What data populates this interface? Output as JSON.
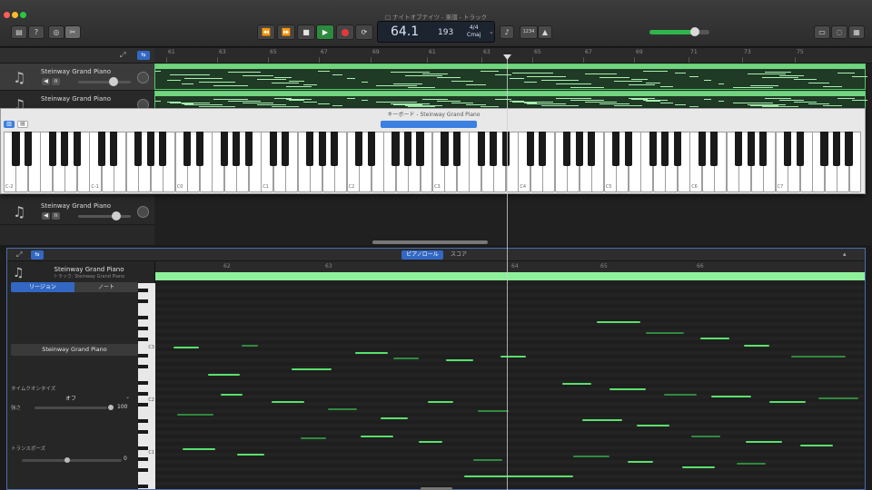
{
  "window": {
    "title": "□ ナイトオブナイツ - 楽譜 - トラック"
  },
  "toolbar": {
    "library_icon": "library-icon",
    "quick_help_icon": "help-icon",
    "smart_controls_icon": "smart-controls-icon",
    "editors_icon": "scissors-icon",
    "rewind_label": "⏪",
    "forward_label": "⏩",
    "stop_label": "■",
    "play_label": "▶",
    "cycle_label": "⟳",
    "lcd": {
      "position": "64.1",
      "tempo": "193",
      "time_signature": "4/4",
      "key": "Cmaj"
    },
    "tuner_label": "♪",
    "count_in_label": "1234",
    "metronome_label": "▲"
  },
  "tracks": [
    {
      "name": "Steinway Grand Piano"
    },
    {
      "name": "Steinway Grand Piano"
    },
    {
      "name": "Steinway Grand Piano"
    }
  ],
  "ruler": {
    "bars": [
      "61",
      "63",
      "65",
      "67",
      "69",
      "61",
      "63",
      "65",
      "67",
      "69",
      "71",
      "73",
      "75"
    ]
  },
  "keyboard": {
    "title": "キーボード - Steinway Grand Piano",
    "octave_labels": [
      "C-2",
      "C-1",
      "C0",
      "C1",
      "C2",
      "C3",
      "C4",
      "C5",
      "C6",
      "C7"
    ]
  },
  "editor": {
    "tabs": {
      "piano_roll": "ピアノロール",
      "score": "スコア"
    },
    "track_name": "Steinway Grand Piano",
    "track_sub": "トラック: Steinway Grand Piano",
    "segments": {
      "region": "リージョン",
      "note": "ノート"
    },
    "region_name": "Steinway Grand Piano",
    "time_quantize_label": "タイムクオンタイズ",
    "time_quantize_value": "オフ",
    "strength_label": "強さ",
    "strength_value": "100",
    "transpose_label": "トランスポーズ",
    "transpose_value": "0",
    "ruler_marks": [
      "62",
      "63",
      "64",
      "65",
      "66"
    ],
    "piano_labels": [
      "C3",
      "C2",
      "C1"
    ]
  }
}
